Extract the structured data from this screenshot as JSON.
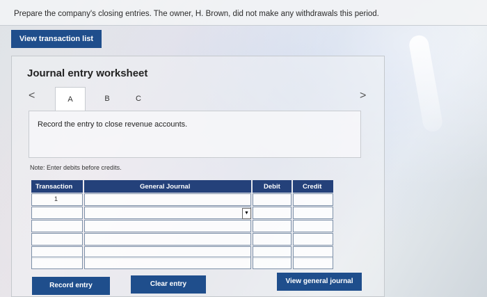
{
  "prompt": "Prepare the company's closing entries. The owner, H. Brown, did not make any withdrawals this period.",
  "view_transaction_list": "View transaction list",
  "worksheet": {
    "title": "Journal entry worksheet",
    "nav_prev": "<",
    "nav_next": ">",
    "tabs": [
      "A",
      "B",
      "C"
    ],
    "instruction": "Record the entry to close revenue accounts.",
    "note": "Note: Enter debits before credits."
  },
  "table": {
    "headers": {
      "transaction": "Transaction",
      "general_journal": "General Journal",
      "debit": "Debit",
      "credit": "Credit"
    },
    "first_row_number": "1"
  },
  "buttons": {
    "record": "Record entry",
    "clear": "Clear entry",
    "view_general_journal": "View general journal"
  },
  "colors": {
    "button_blue": "#1f4e8c",
    "header_navy": "#24417a"
  }
}
